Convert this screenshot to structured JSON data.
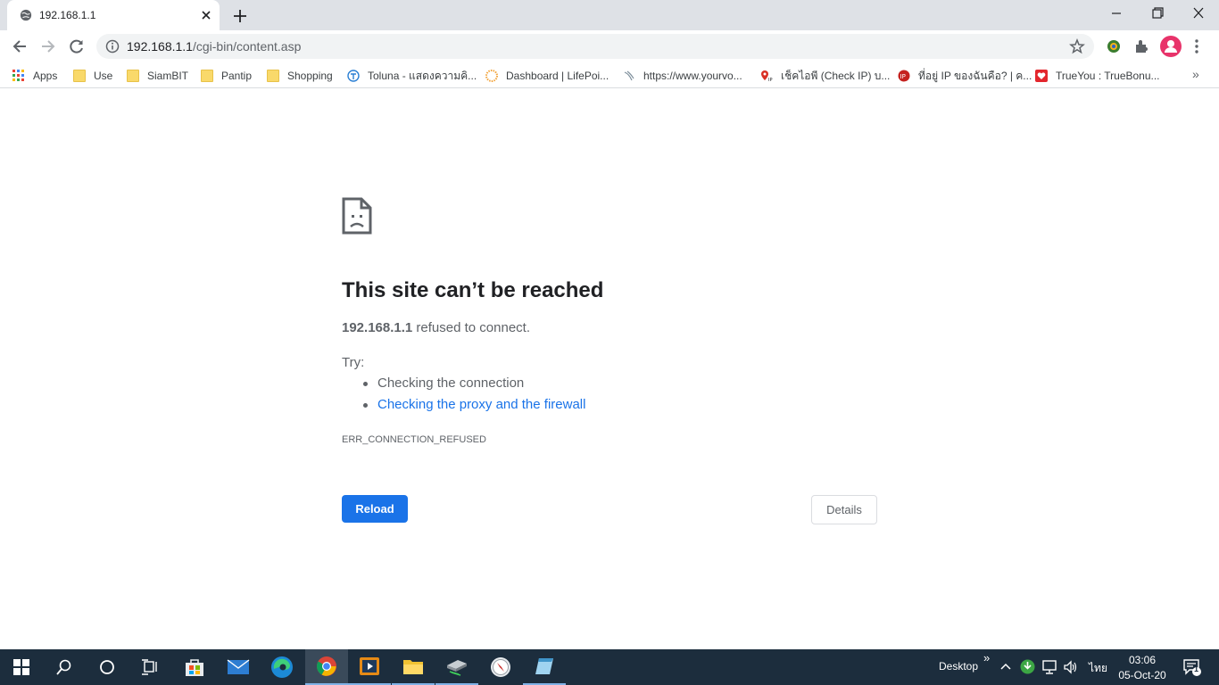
{
  "browser": {
    "tab": {
      "title": "192.168.1.1"
    },
    "omnibox": {
      "url_host": "192.168.1.1",
      "url_path": "/cgi-bin/content.asp"
    },
    "bookmarks": [
      {
        "label": "Apps",
        "icon": "apps-grid-icon"
      },
      {
        "label": "Use",
        "icon": "folder-icon"
      },
      {
        "label": "SiamBIT",
        "icon": "folder-icon"
      },
      {
        "label": "Pantip",
        "icon": "folder-icon"
      },
      {
        "label": "Shopping",
        "icon": "folder-icon"
      },
      {
        "label": "Toluna - แสดงความคิ...",
        "icon": "toluna-icon"
      },
      {
        "label": "Dashboard | LifePoi...",
        "icon": "lifepoints-icon"
      },
      {
        "label": "https://www.yourvo...",
        "icon": "yourvoice-icon"
      },
      {
        "label": "เช็คไอพี (Check IP) บ...",
        "icon": "checkip-icon"
      },
      {
        "label": "ที่อยู่ IP ของฉันคือ? | ค...",
        "icon": "myip-icon"
      },
      {
        "label": "TrueYou : TrueBonu...",
        "icon": "trueyou-icon"
      }
    ],
    "colors": {
      "accent": "#1a73e8",
      "tabstrip": "#dee1e6",
      "taskbar": "#1c2d3d"
    }
  },
  "error": {
    "title": "This site can’t be reached",
    "host": "192.168.1.1",
    "description": "refused to connect.",
    "try_label": "Try:",
    "suggestions": [
      "Checking the connection",
      "Checking the proxy and the firewall"
    ],
    "code": "ERR_CONNECTION_REFUSED",
    "reload_label": "Reload",
    "details_label": "Details"
  },
  "taskbar": {
    "apps": [
      "start-icon",
      "search-icon",
      "cortana-icon",
      "task-view-icon",
      "store-icon",
      "mail-icon",
      "edge-icon",
      "chrome-icon",
      "media-player-icon",
      "file-explorer-icon",
      "scanner-icon",
      "compass-icon",
      "notepad-icon"
    ],
    "desktop_label": "Desktop",
    "language": "ไทย",
    "time": "03:06",
    "date": "05-Oct-20",
    "notification_count": "1"
  }
}
